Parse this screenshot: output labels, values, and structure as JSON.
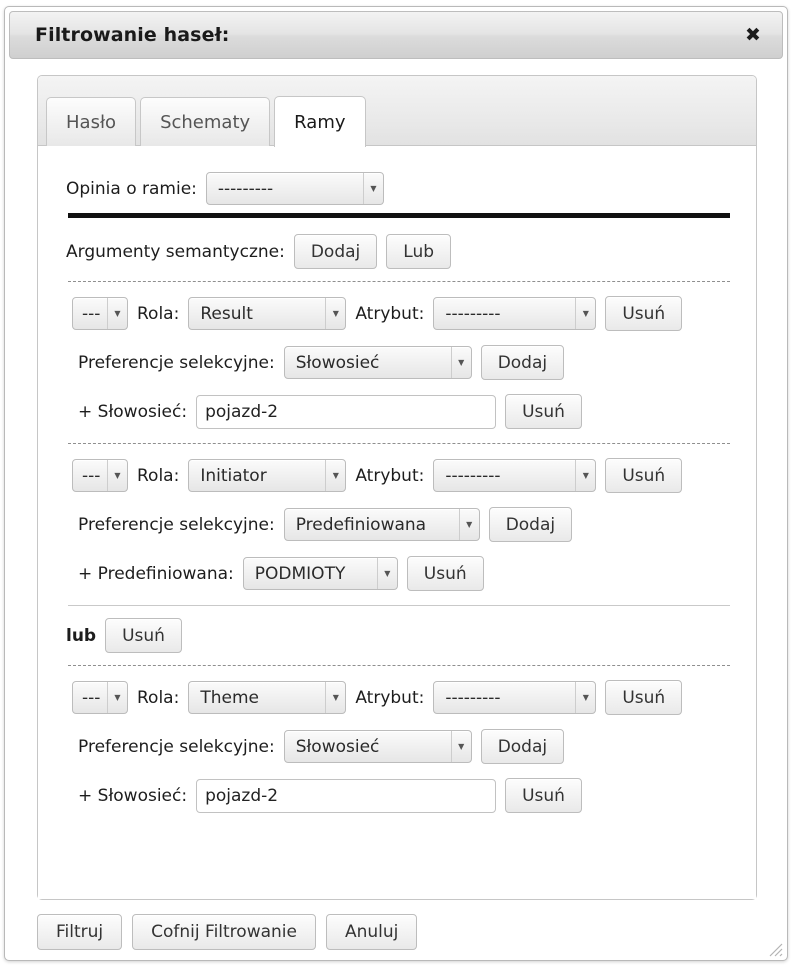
{
  "window": {
    "title": "Filtrowanie haseł:",
    "close_icon": "close-icon",
    "close_glyph": "✖",
    "resize_grip_icon": "resize-grip-icon"
  },
  "tabs": [
    {
      "label": "Hasło",
      "active": false
    },
    {
      "label": "Schematy",
      "active": false
    },
    {
      "label": "Ramy",
      "active": true
    }
  ],
  "form": {
    "opinia_label": "Opinia o ramie:",
    "opinia_value": "---------",
    "arguments_label": "Argumenty semantyczne:",
    "add_label": "Dodaj",
    "or_label": "Lub"
  },
  "labels": {
    "rola": "Rola:",
    "atrybut": "Atrybut:",
    "preferencje": "Preferencje selekcyjne:",
    "dodaj": "Dodaj",
    "usun": "Usuń",
    "lub_bold": "lub",
    "plus_slowosiec": "+ Słowosieć:",
    "plus_predefiniowana": "+ Predefiniowana:"
  },
  "arguments": [
    {
      "prefix_value": "---",
      "rola_value": "Result",
      "atrybut_value": "---------",
      "preference_type": "Słowosieć",
      "detail_kind": "text",
      "detail_label": "+ Słowosieć:",
      "detail_value": "pojazd-2"
    },
    {
      "prefix_value": "---",
      "rola_value": "Initiator",
      "atrybut_value": "---------",
      "preference_type": "Predefiniowana",
      "detail_kind": "select",
      "detail_label": "+ Predefiniowana:",
      "detail_value": "PODMIOTY"
    },
    {
      "prefix_value": "---",
      "rola_value": "Theme",
      "atrybut_value": "---------",
      "preference_type": "Słowosieć",
      "detail_kind": "text",
      "detail_label": "+ Słowosieć:",
      "detail_value": "pojazd-2"
    }
  ],
  "footer": {
    "filter_label": "Filtruj",
    "undo_label": "Cofnij Filtrowanie",
    "cancel_label": "Anuluj"
  },
  "colors": {
    "accent": "#d0d0d0",
    "text": "#1d1d1d",
    "border": "#bdbdbd"
  }
}
